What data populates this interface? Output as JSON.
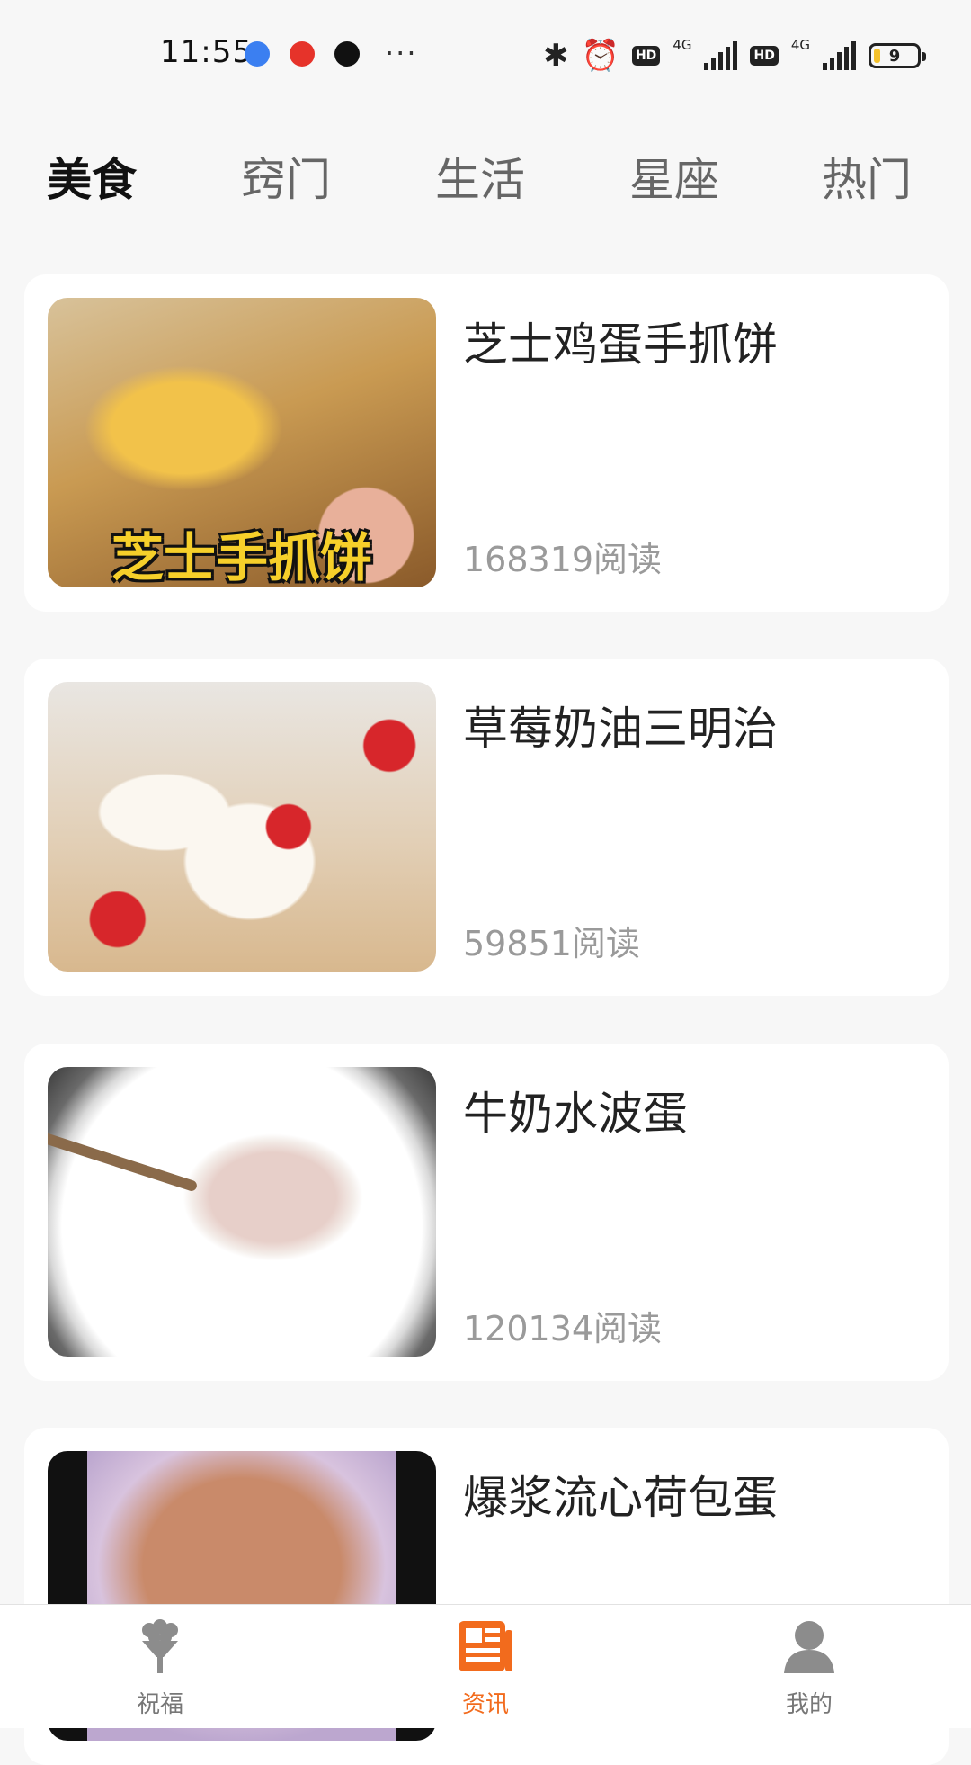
{
  "status_bar": {
    "time": "11:55",
    "app_icons": [
      "baidu-icon",
      "weibo-icon",
      "qq-icon"
    ],
    "more": "···",
    "hd_1": "HD",
    "net_1": "4G",
    "hd_2": "HD",
    "net_2": "4G",
    "battery": "9",
    "battery_color": "#f4c12a"
  },
  "category_tabs": [
    {
      "label": "美食",
      "active": true
    },
    {
      "label": "窍门",
      "active": false
    },
    {
      "label": "生活",
      "active": false
    },
    {
      "label": "星座",
      "active": false
    },
    {
      "label": "热门",
      "active": false
    }
  ],
  "feed": [
    {
      "title": "芝士鸡蛋手抓饼",
      "reads": "168319阅读",
      "image_caption": "芝士手抓饼"
    },
    {
      "title": "草莓奶油三明治",
      "reads": "59851阅读"
    },
    {
      "title": "牛奶水波蛋",
      "reads": "120134阅读"
    },
    {
      "title": "爆浆流心荷包蛋",
      "reads": ""
    }
  ],
  "bottom_nav": [
    {
      "label": "祝福",
      "icon": "bouquet-icon",
      "active": false
    },
    {
      "label": "资讯",
      "icon": "news-icon",
      "active": true
    },
    {
      "label": "我的",
      "icon": "user-icon",
      "active": false
    }
  ],
  "colors": {
    "accent": "#f26b1d",
    "inactive": "#777777",
    "reads": "#9a9a9a"
  }
}
